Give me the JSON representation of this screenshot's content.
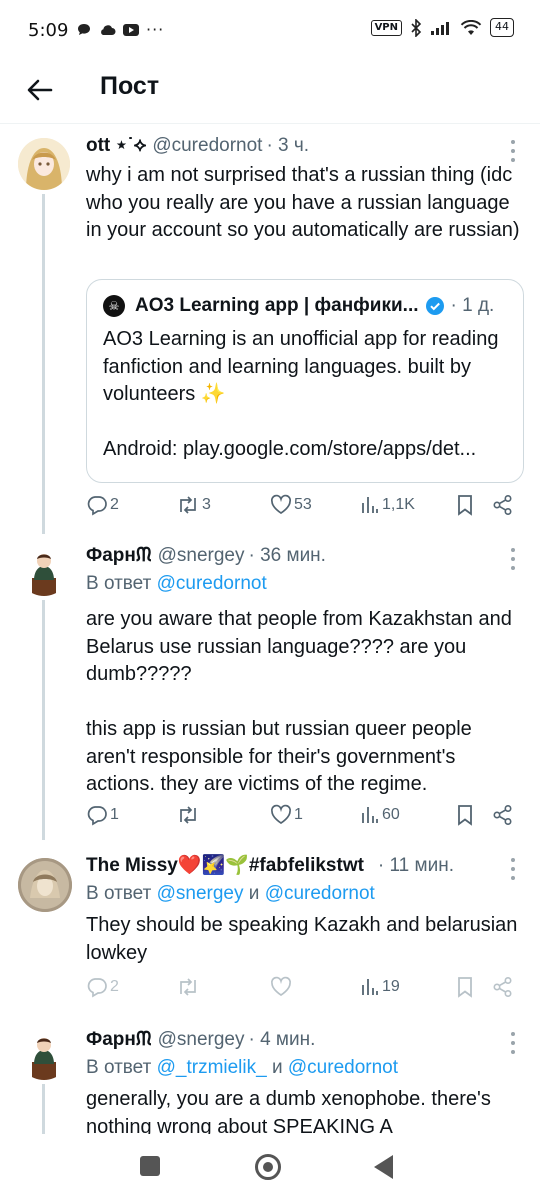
{
  "status_bar": {
    "time": "5:09",
    "icons_left": [
      "chat-bubble-icon",
      "cloud-icon",
      "youtube-icon",
      "more-dots-icon"
    ],
    "vpn": "VPN",
    "battery": "44"
  },
  "header": {
    "title": "Пост"
  },
  "tweets": [
    {
      "name": "ott ⋆˙⟡",
      "handle": "@curedornot",
      "time": "· 3 ч.",
      "text": "why i am not surprised that's a russian thing (idc who you really are you have a russian language in your account so you automatically are russian)",
      "quote": {
        "name": "AO3 Learning app | фанфики...",
        "time": "· 1 д.",
        "text": "AO3 Learning is an unofficial app for reading fanfiction and learning languages. built by volunteers ✨\n\nAndroid: play.google.com/store/apps/det..."
      },
      "stats": {
        "replies": "2",
        "reposts": "3",
        "likes": "53",
        "views": "1,1K"
      }
    },
    {
      "name": "Фарнᙏ",
      "handle": "@snergey",
      "time": "· 36 мин.",
      "reply_prefix": "В ответ",
      "reply_to_1": "@curedornot",
      "text": "are you aware that people from Kazakhstan and Belarus use russian language???? are you dumb?????\n\nthis app is russian but russian queer people aren't responsible for their's government's actions. they are victims of the regime.",
      "stats": {
        "replies": "1",
        "reposts": "",
        "likes": "1",
        "views": "60"
      }
    },
    {
      "name": "The Missy❤️🌠🌱#fabfelikstwt",
      "handle": "",
      "time": "· 11 мин.",
      "reply_prefix": "В ответ",
      "reply_to_1": "@snergey",
      "reply_conj": "и",
      "reply_to_2": "@curedornot",
      "text": "They should be speaking Kazakh and belarusian lowkey",
      "stats": {
        "replies": "2",
        "reposts": "",
        "likes": "",
        "views": "19"
      }
    },
    {
      "name": "Фарнᙏ",
      "handle": "@snergey",
      "time": "· 4 мин.",
      "reply_prefix": "В ответ",
      "reply_to_1": "@_trzmielik_",
      "reply_conj": "и",
      "reply_to_2": "@curedornot",
      "text": "generally, you are a dumb xenophobe. there's nothing wrong about SPEAKING A"
    }
  ],
  "colors": {
    "accent": "#1d9bf0",
    "secondary_text": "#536471",
    "border": "#cfd9de"
  }
}
